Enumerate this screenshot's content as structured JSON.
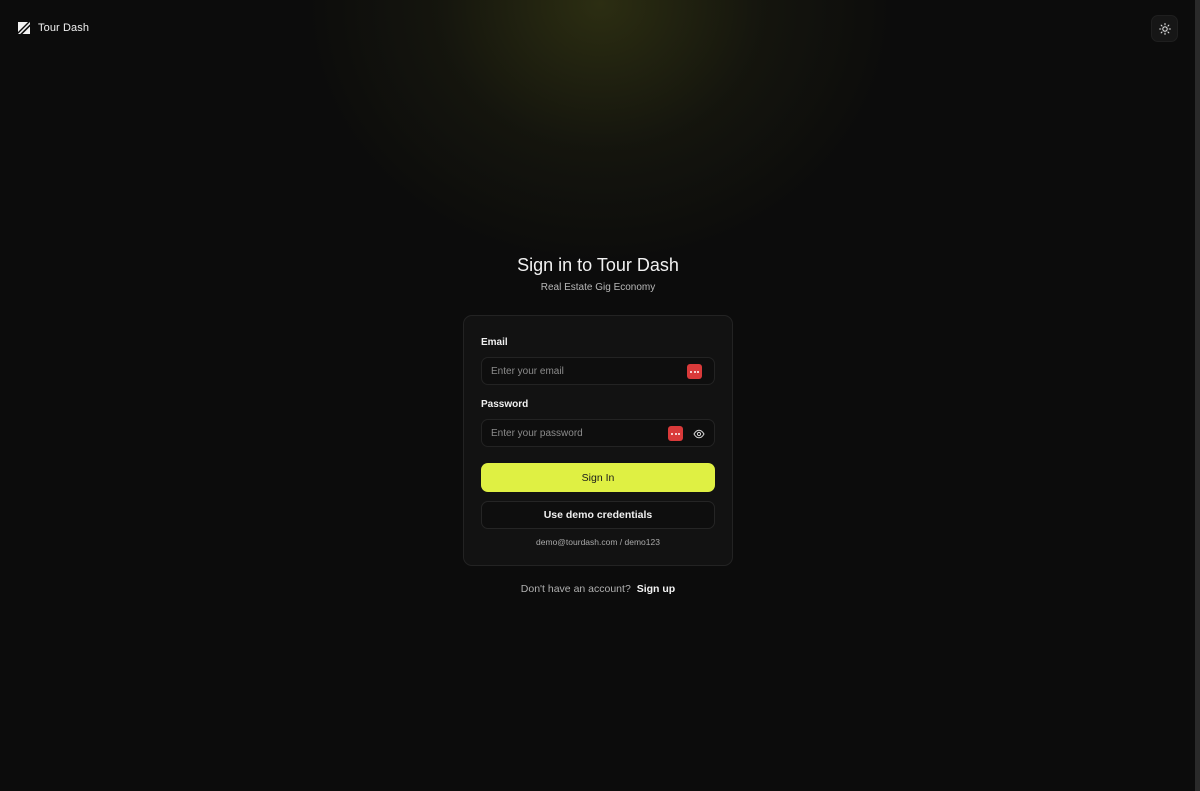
{
  "app": {
    "brand_name": "Tour Dash"
  },
  "header": {
    "theme_toggle_icon": "sun-icon"
  },
  "login": {
    "title": "Sign in to Tour Dash",
    "subtitle": "Real Estate Gig Economy",
    "email": {
      "label": "Email",
      "placeholder": "Enter your email",
      "value": ""
    },
    "password": {
      "label": "Password",
      "placeholder": "Enter your password",
      "value": "",
      "toggle_icon": "eye-icon"
    },
    "sign_in_label": "Sign In",
    "demo_button_label": "Use demo credentials",
    "demo_hint": "demo@tourdash.com / demo123"
  },
  "footer": {
    "prompt": "Don't have an account?",
    "signup_label": "Sign up"
  },
  "colors": {
    "background": "#0c0c0c",
    "accent": "#dff043",
    "password_manager_badge": "#d93a3a"
  }
}
